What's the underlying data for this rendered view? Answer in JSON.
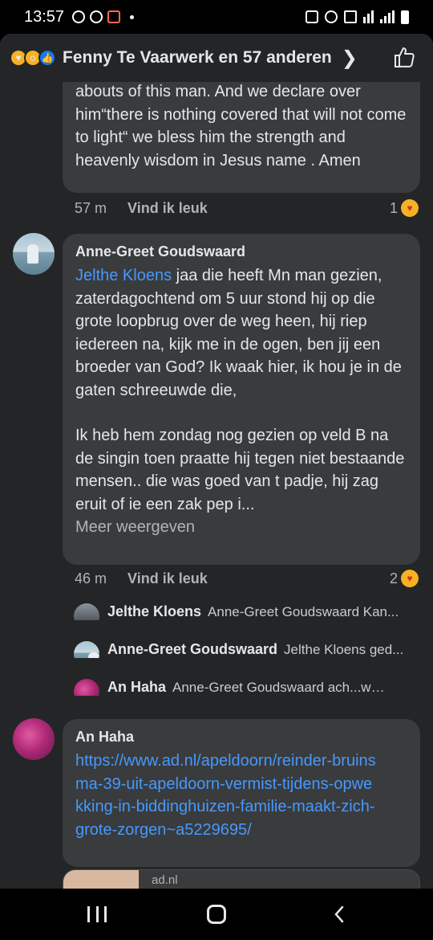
{
  "status": {
    "time": "13:57"
  },
  "header": {
    "title": "Fenny Te Vaarwerk en 57 anderen"
  },
  "comments": [
    {
      "text": "abouts of this man. And we declare over him“there is nothing covered that will not come to light“ we bless him the strength and heavenly wisdom in Jesus name . Amen",
      "time": "57 m",
      "like_label": "Vind ik leuk",
      "reaction_count": "1"
    },
    {
      "author": "Anne-Greet Goudswaard",
      "mention": "Jelthe Kloens",
      "text_1": " jaa die heeft Mn man gezien, zaterdagochtend om 5 uur stond hij op die grote loopbrug over de weg heen, hij riep iedereen na, kijk me in de ogen, ben jij een broeder van God? Ik waak hier, ik hou je in de gaten schreeuwde die,",
      "text_2": "Ik heb hem zondag nog gezien op veld B na de singin toen praatte hij tegen niet bestaande mensen.. die was goed van t padje, hij zag eruit of ie een zak pep i...",
      "more_label": "Meer weergeven",
      "time": "46 m",
      "like_label": "Vind ik leuk",
      "reaction_count": "2"
    },
    {
      "author": "An Haha",
      "link": "https://www.ad.nl/apeldoorn/reinder-bruinsma-39-uit-apeldoorn-vermist-tijdens-opwekking-in-biddinghuizen-familie-maakt-zich-grote-zorgen~a5229695/",
      "preview_domain": "ad.nl"
    }
  ],
  "replies": [
    {
      "name": "Jelthe Kloens",
      "text": "Anne-Greet Goudswaard Kan..."
    },
    {
      "name": "Anne-Greet Goudswaard",
      "text": "Jelthe Kloens ged..."
    },
    {
      "name": "An Haha",
      "text": "Anne-Greet Goudswaard ach...wat..."
    }
  ]
}
